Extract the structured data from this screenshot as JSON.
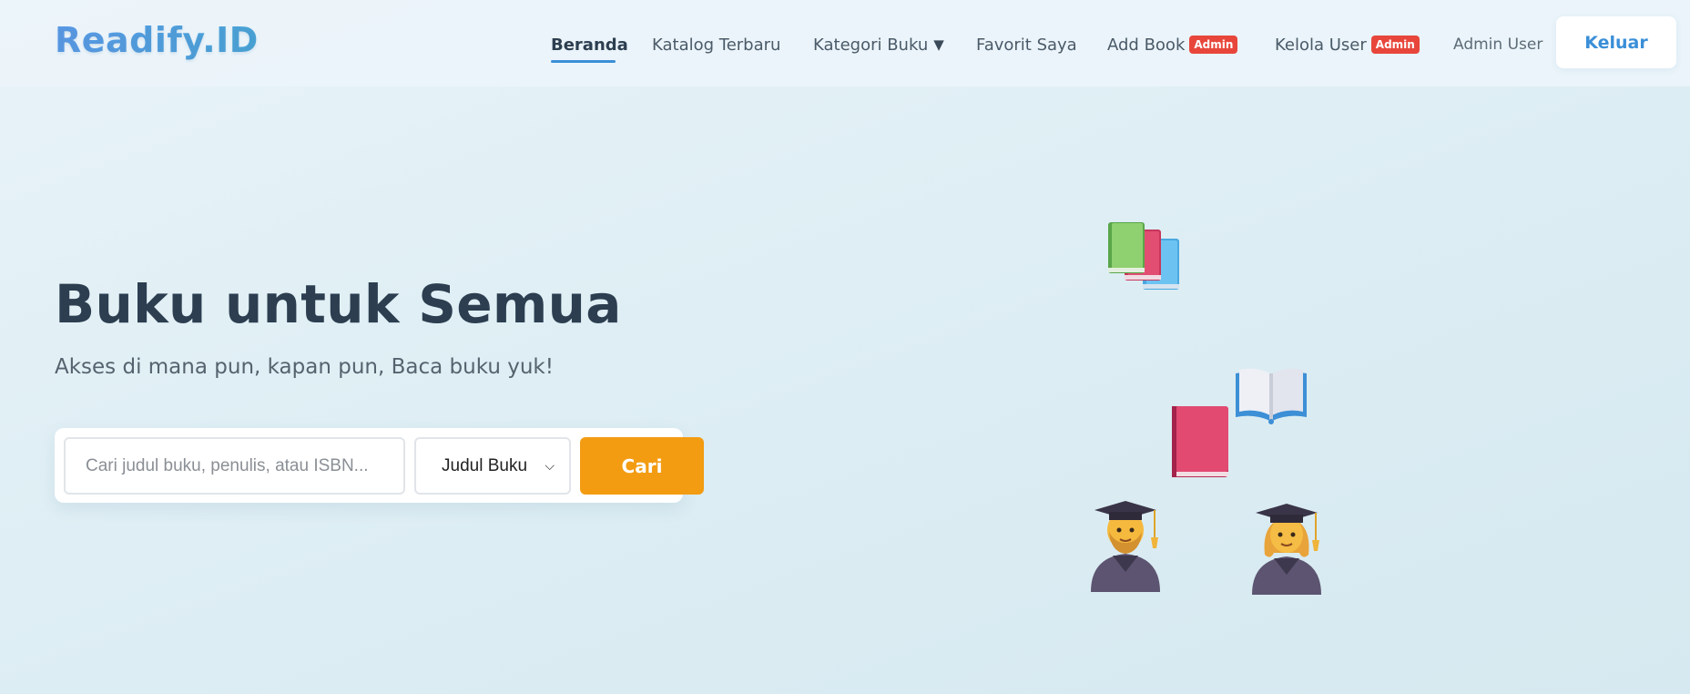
{
  "brand": {
    "logo_text": "Readify.ID"
  },
  "nav": {
    "items": [
      {
        "label": "Beranda",
        "active": true
      },
      {
        "label": "Katalog Terbaru"
      },
      {
        "label": "Kategori Buku"
      },
      {
        "label": "Favorit Saya"
      },
      {
        "label": "Add Book",
        "badge": "Admin"
      },
      {
        "label": "Kelola User",
        "badge": "Admin"
      }
    ],
    "user_name": "Admin User",
    "logout_label": "Keluar"
  },
  "hero": {
    "title": "Buku untuk Semua",
    "subtitle": "Akses di mana pun, kapan pun, Baca buku yuk!"
  },
  "search": {
    "placeholder": "Cari judul buku, penulis, atau ISBN...",
    "filter_selected": "Judul Buku",
    "button_label": "Cari"
  },
  "illustration": {
    "icons": [
      "books-stack-icon",
      "open-book-icon",
      "closed-book-icon",
      "man-student-icon",
      "woman-student-icon"
    ]
  },
  "colors": {
    "accent": "#3a8fd8",
    "search_button": "#f39c12",
    "badge": "#e8463b",
    "title": "#2c3e50"
  }
}
